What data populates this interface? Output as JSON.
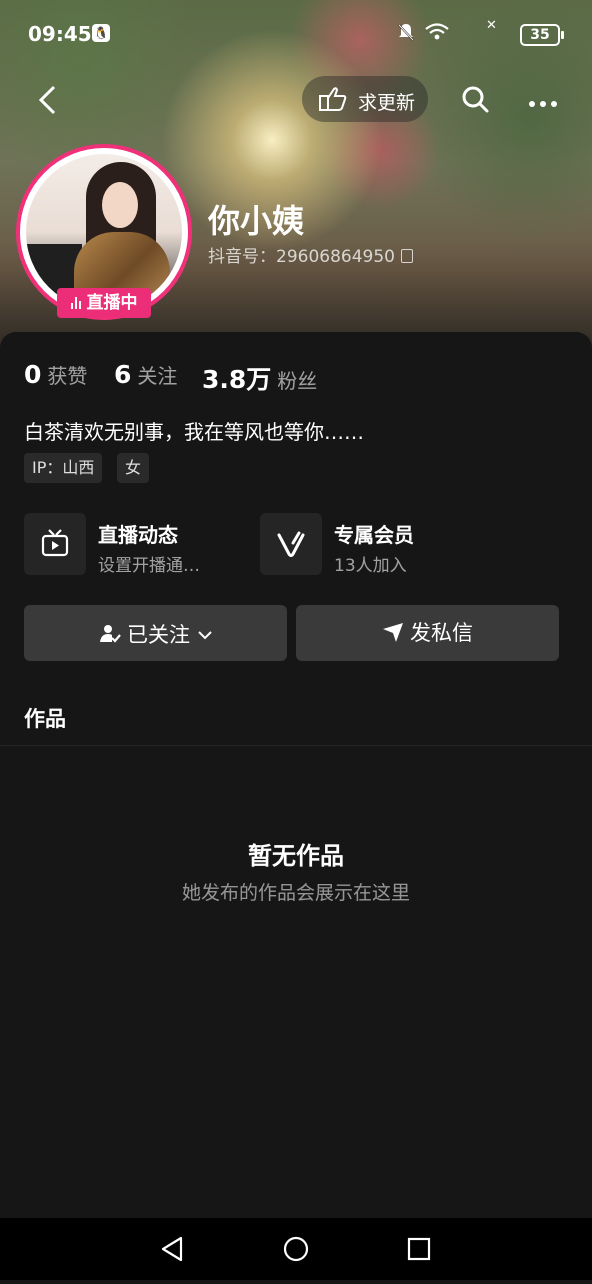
{
  "status": {
    "time": "09:45",
    "qq_glyph": "🐧",
    "battery": "35",
    "icons": [
      "silent-bell-icon",
      "wifi-icon",
      "signal-icon",
      "battery-icon"
    ]
  },
  "header": {
    "request_update_label": "求更新"
  },
  "profile": {
    "username": "你小姨",
    "douyin_id_label": "抖音号：",
    "douyin_id": "29606864950",
    "live_badge": "直播中"
  },
  "stats": [
    {
      "num": "0",
      "label": "获赞"
    },
    {
      "num": "6",
      "label": "关注"
    },
    {
      "num": "3.8万",
      "label": "粉丝"
    }
  ],
  "bio": "白茶清欢无别事，我在等风也等你……",
  "tags": [
    "IP：山西",
    "女"
  ],
  "features": [
    {
      "title": "直播动态",
      "sub": "设置开播通…",
      "icon": "tv-icon"
    },
    {
      "title": "专属会员",
      "sub": "13人加入",
      "icon": "vip-v-icon"
    }
  ],
  "buttons": {
    "followed": "已关注",
    "message": "发私信"
  },
  "works": {
    "tab_label": "作品",
    "empty_title": "暂无作品",
    "empty_sub": "她发布的作品会展示在这里"
  },
  "colors": {
    "accent": "#ec2d77",
    "background": "#161616",
    "button": "#3a3a3a"
  }
}
